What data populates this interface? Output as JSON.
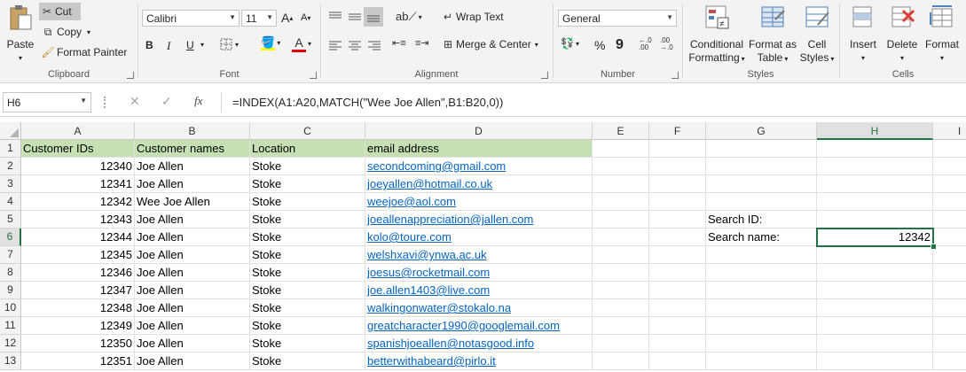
{
  "ribbon": {
    "clipboard": {
      "paste": "Paste",
      "cut": "Cut",
      "copy": "Copy",
      "format_painter": "Format Painter",
      "label": "Clipboard"
    },
    "font": {
      "name": "Calibri",
      "size": "11",
      "bold": "B",
      "italic": "I",
      "underline": "U",
      "label": "Font"
    },
    "alignment": {
      "wrap_text": "Wrap Text",
      "merge_center": "Merge & Center",
      "label": "Alignment"
    },
    "number": {
      "format": "General",
      "percent": "%",
      "comma": "9",
      "label": "Number"
    },
    "styles": {
      "conditional_1": "Conditional",
      "conditional_2": "Formatting",
      "format_as_1": "Format as",
      "format_as_2": "Table",
      "cell_styles_1": "Cell",
      "cell_styles_2": "Styles",
      "label": "Styles"
    },
    "cells": {
      "insert": "Insert",
      "delete": "Delete",
      "format": "Format",
      "label": "Cells"
    }
  },
  "formula_bar": {
    "name_box": "H6",
    "formula": "=INDEX(A1:A20,MATCH(\"Wee Joe Allen\",B1:B20,0))"
  },
  "grid": {
    "columns": [
      "A",
      "B",
      "C",
      "D",
      "E",
      "F",
      "G",
      "H",
      "I"
    ],
    "row_numbers": [
      "1",
      "2",
      "3",
      "4",
      "5",
      "6",
      "7",
      "8",
      "9",
      "10",
      "11",
      "12",
      "13"
    ],
    "headers": {
      "a": "Customer IDs",
      "b": "Customer names",
      "c": "Location",
      "d": "email address"
    },
    "rows": [
      {
        "id": "12340",
        "name": "Joe Allen",
        "location": "Stoke",
        "email": "secondcoming@gmail.com"
      },
      {
        "id": "12341",
        "name": "Joe Allen",
        "location": "Stoke",
        "email": "joeyallen@hotmail.co.uk"
      },
      {
        "id": "12342",
        "name": "Wee Joe Allen",
        "location": "Stoke",
        "email": "weejoe@aol.com"
      },
      {
        "id": "12343",
        "name": "Joe Allen",
        "location": "Stoke",
        "email": "joeallenappreciation@jallen.com"
      },
      {
        "id": "12344",
        "name": "Joe Allen",
        "location": "Stoke",
        "email": "kolo@toure.com"
      },
      {
        "id": "12345",
        "name": "Joe Allen",
        "location": "Stoke",
        "email": "welshxavi@ynwa.ac.uk"
      },
      {
        "id": "12346",
        "name": "Joe Allen",
        "location": "Stoke",
        "email": "joesus@rocketmail.com"
      },
      {
        "id": "12347",
        "name": "Joe Allen",
        "location": "Stoke",
        "email": "joe.allen1403@live.com"
      },
      {
        "id": "12348",
        "name": "Joe Allen",
        "location": "Stoke",
        "email": "walkingonwater@stokalo.na"
      },
      {
        "id": "12349",
        "name": "Joe Allen",
        "location": "Stoke",
        "email": "greatcharacter1990@googlemail.com"
      },
      {
        "id": "12350",
        "name": "Joe Allen",
        "location": "Stoke",
        "email": "spanishjoeallen@notasgood.info"
      },
      {
        "id": "12351",
        "name": "Joe Allen",
        "location": "Stoke",
        "email": "betterwithabeard@pirlo.it"
      }
    ],
    "search_id_label": "Search ID:",
    "search_name_label": "Search name:",
    "result": "12342"
  },
  "colors": {
    "header_fill": "#c6e0b4",
    "link": "#0563c1",
    "selection": "#217346"
  }
}
